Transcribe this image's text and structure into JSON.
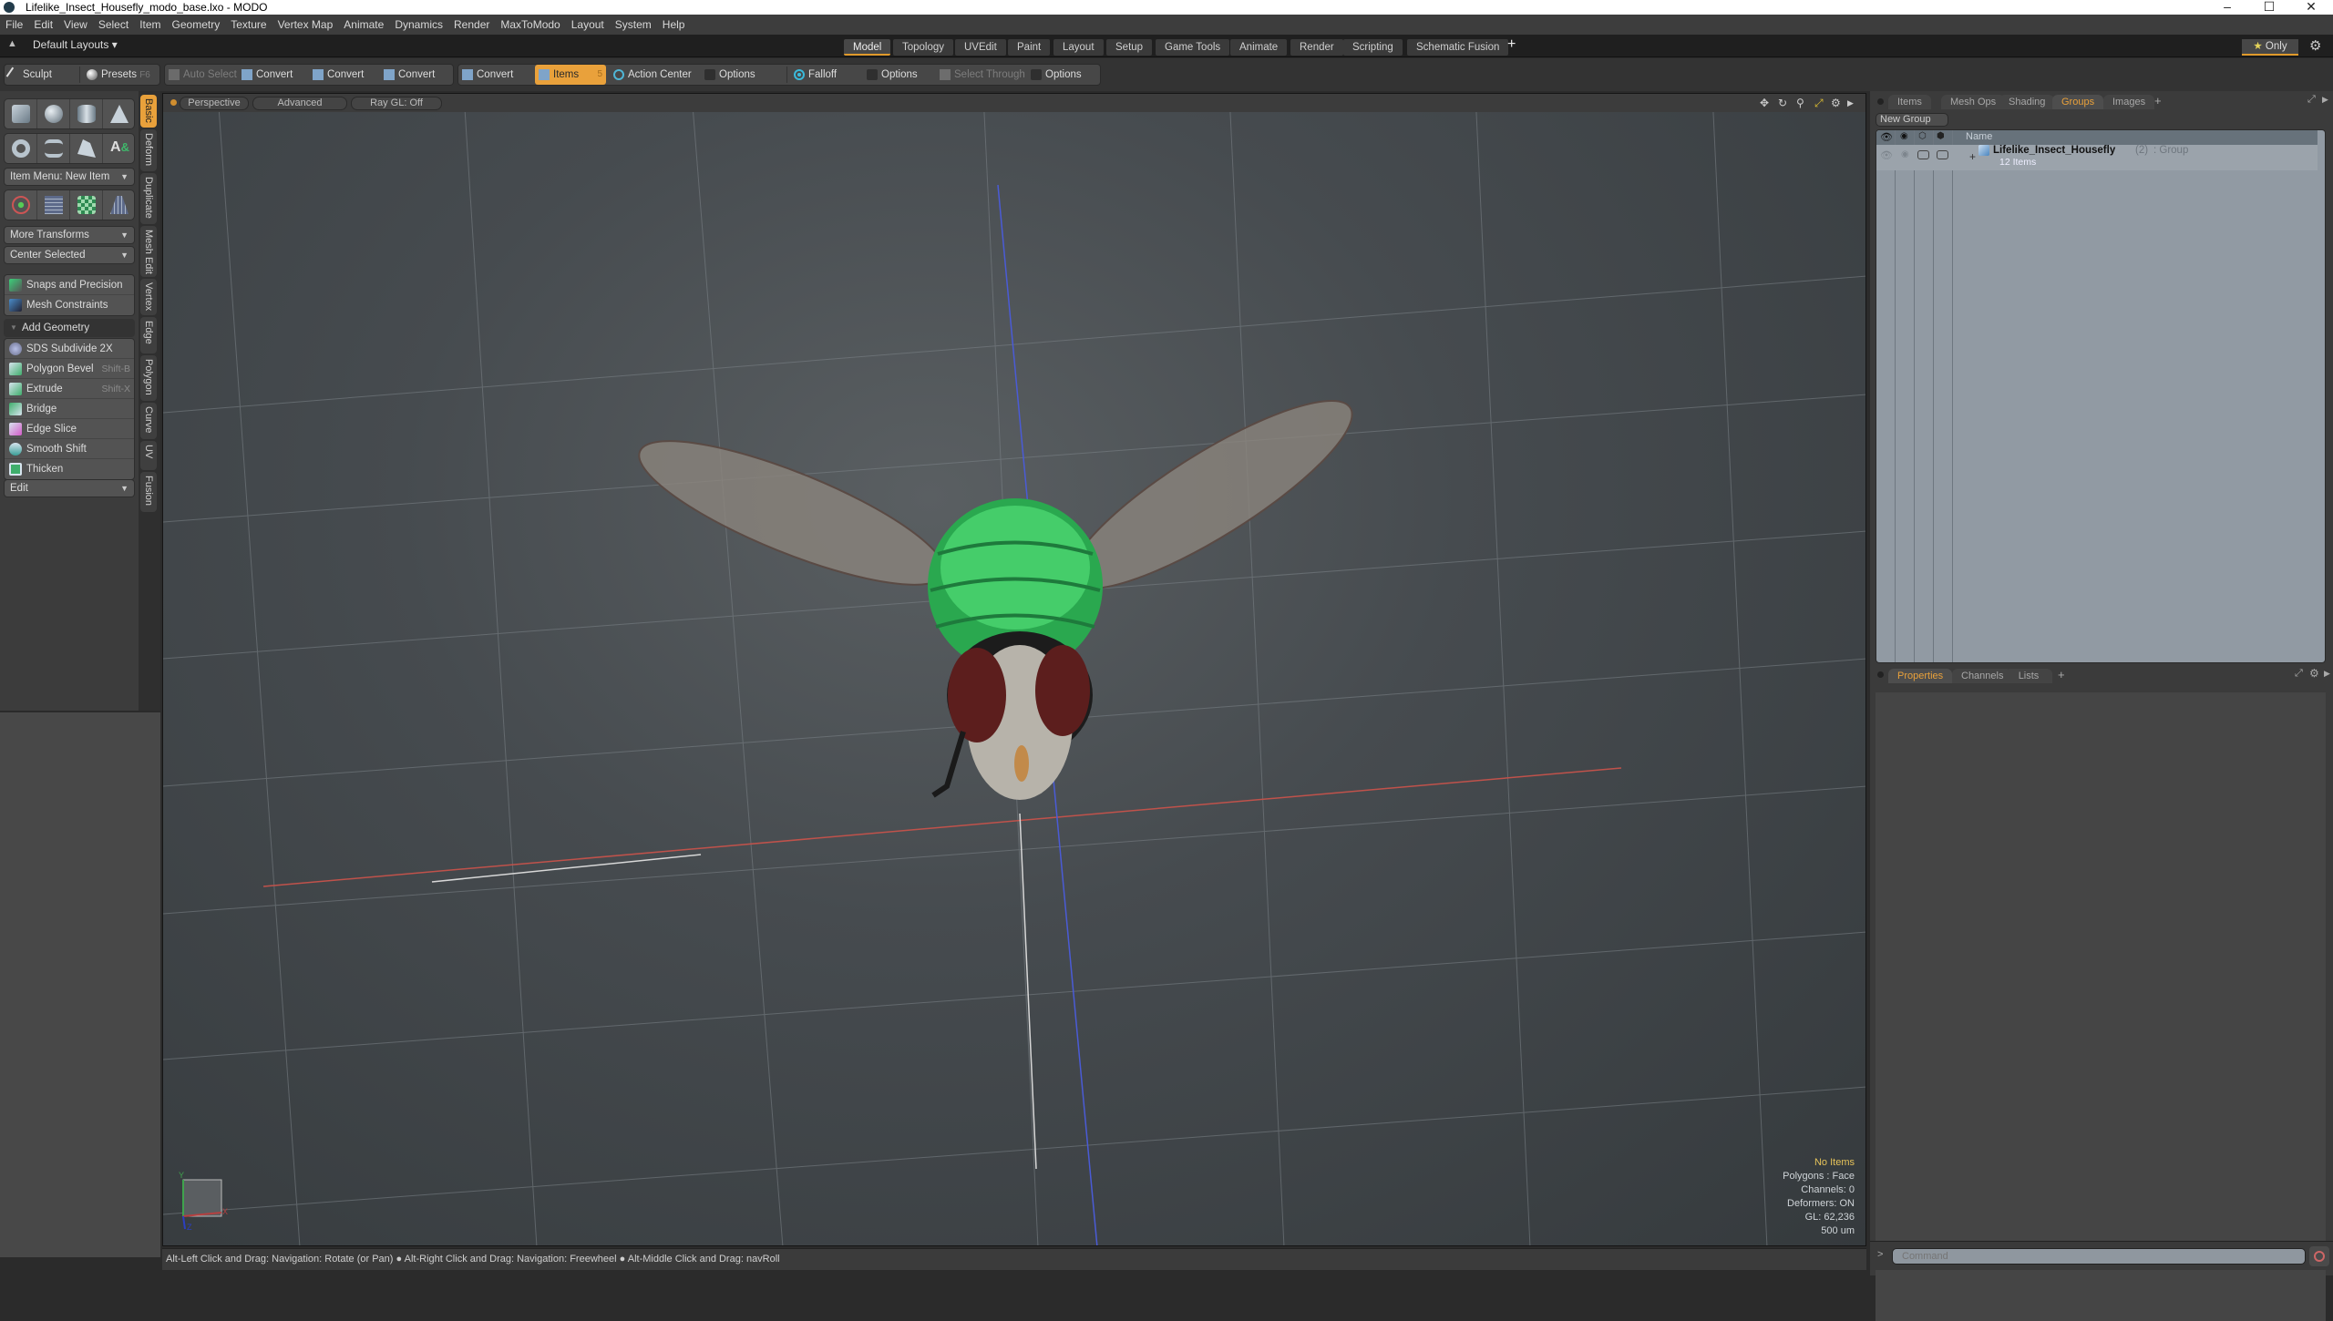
{
  "window": {
    "title": "Lifelike_Insect_Housefly_modo_base.lxo - MODO",
    "minimize_icon": "minimize-icon",
    "maximize_icon": "maximize-icon",
    "close_icon": "close-icon"
  },
  "menubar": [
    "File",
    "Edit",
    "View",
    "Select",
    "Item",
    "Geometry",
    "Texture",
    "Vertex Map",
    "Animate",
    "Dynamics",
    "Render",
    "MaxToModo",
    "Layout",
    "System",
    "Help"
  ],
  "layoutbar": {
    "layouts_label": "Default Layouts ▾",
    "tabs": [
      "Model",
      "Topology",
      "UVEdit",
      "Paint",
      "Layout",
      "Setup",
      "Game Tools",
      "Animate",
      "Render",
      "Scripting",
      "Schematic Fusion"
    ],
    "active_tab": "Model",
    "add_tab": "+",
    "only_label": "Only",
    "accent": "#e09a2b"
  },
  "toolbar": {
    "sculpt": "Sculpt",
    "presets": "Presets",
    "presets_key": "F6",
    "auto_select": "Auto Select",
    "convert1": "Convert",
    "convert2": "Convert",
    "convert3": "Convert",
    "convert4": "Convert",
    "items": "Items",
    "items_key": "5",
    "action_center": "Action Center",
    "options1": "Options",
    "falloff": "Falloff",
    "options2": "Options",
    "select_through": "Select Through",
    "options3": "Options"
  },
  "leftpanel": {
    "item_menu": "Item Menu: New Item",
    "more_transforms": "More Transforms",
    "center_selected": "Center Selected",
    "snaps": "Snaps and Precision",
    "mesh_constraints": "Mesh Constraints",
    "add_geometry": "Add Geometry",
    "tools": [
      {
        "label": "SDS Subdivide 2X",
        "shortcut": ""
      },
      {
        "label": "Polygon Bevel",
        "shortcut": "Shift-B"
      },
      {
        "label": "Extrude",
        "shortcut": "Shift-X"
      },
      {
        "label": "Bridge",
        "shortcut": ""
      },
      {
        "label": "Edge Slice",
        "shortcut": ""
      },
      {
        "label": "Smooth Shift",
        "shortcut": ""
      },
      {
        "label": "Thicken",
        "shortcut": ""
      }
    ],
    "edit": "Edit",
    "vtabs": [
      "Basic",
      "Deform",
      "Duplicate",
      "Mesh Edit",
      "Vertex",
      "Edge",
      "Polygon",
      "Curve",
      "UV",
      "Fusion"
    ],
    "active_vtab": "Basic"
  },
  "viewport": {
    "view_mode": "Perspective",
    "shading": "Advanced",
    "raygl": "Ray GL: Off",
    "info": {
      "selection": "No Items",
      "polygons": "Polygons : Face",
      "channels": "Channels: 0",
      "deformers": "Deformers: ON",
      "gl": "GL: 62,236",
      "scale": "500 um"
    },
    "axis_labels": {
      "x": "X",
      "y": "Y",
      "z": "Z"
    }
  },
  "statusbar": {
    "hint1": "Alt-Left Click and Drag: Navigation: Rotate (or Pan)",
    "hint2": "Alt-Right Click and Drag: Navigation: Freewheel",
    "hint3": "Alt-Middle Click and Drag: navRoll",
    "bullet": "●"
  },
  "rightpanel": {
    "tabs_top": [
      "Items",
      "Mesh Ops",
      "Shading",
      "Groups",
      "Images"
    ],
    "active_top": "Groups",
    "add": "+",
    "new_group": "New Group",
    "column_name": "Name",
    "group": {
      "expand": "+",
      "name": "Lifelike_Insect_Housefly",
      "count": "(2)",
      "type": ": Group",
      "items": "12 Items"
    },
    "tabs_bottom": [
      "Properties",
      "Channels",
      "Lists"
    ],
    "active_bottom": "Properties",
    "command_placeholder": "Command",
    "prompt": ">"
  }
}
